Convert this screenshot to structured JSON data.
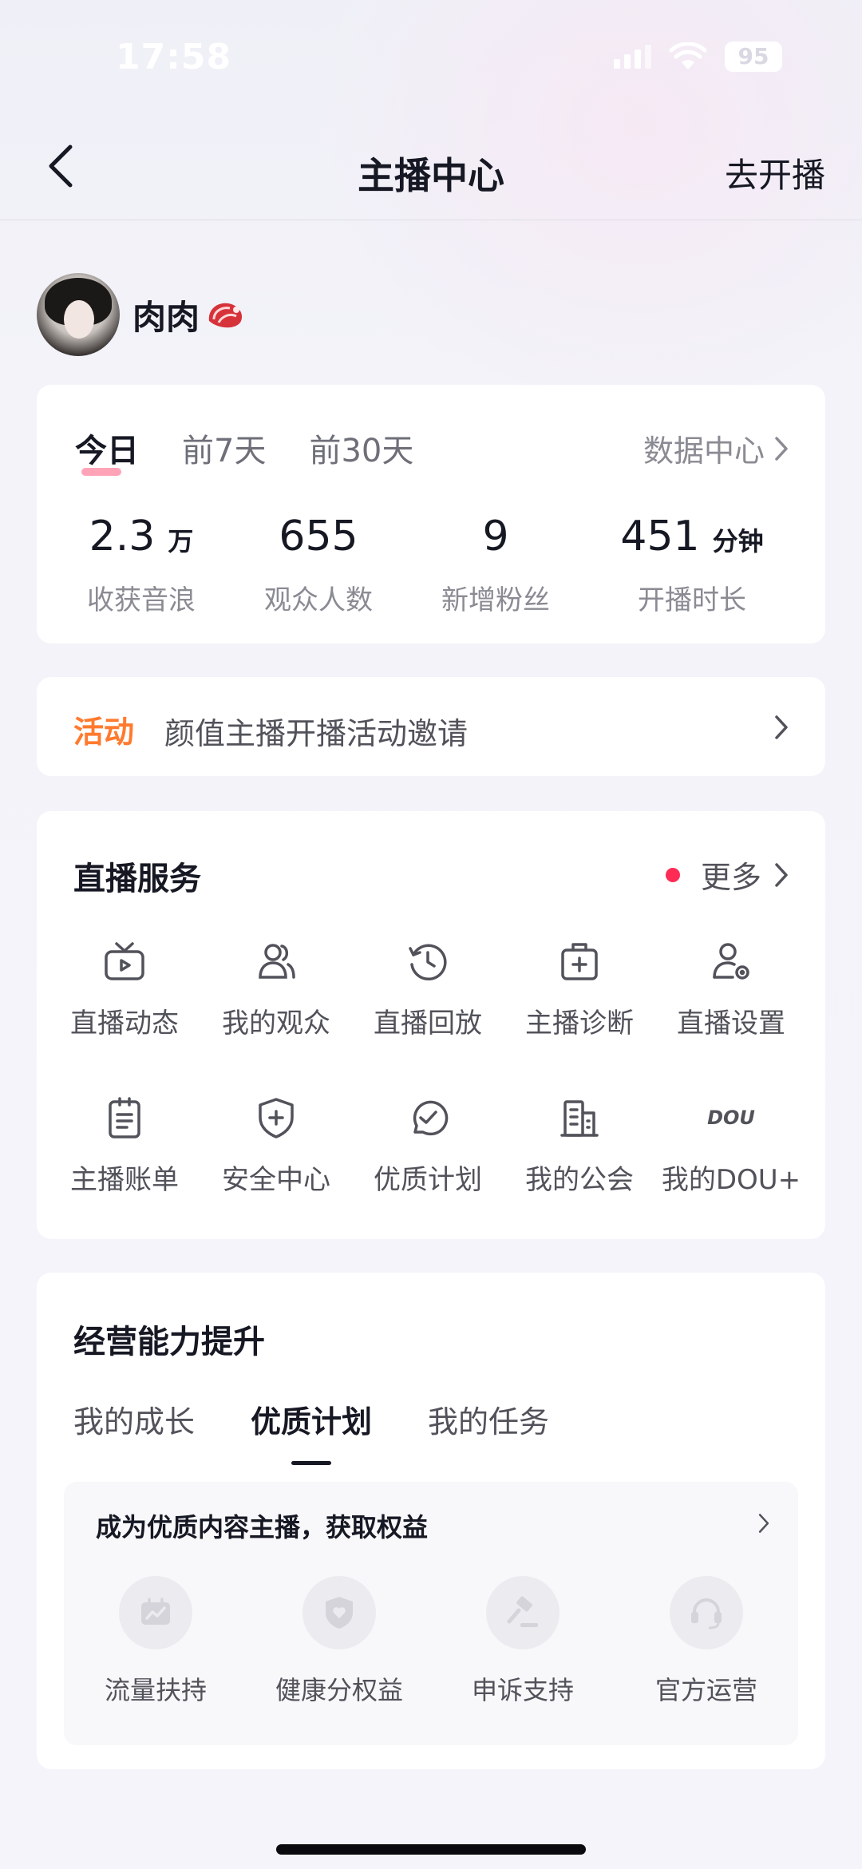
{
  "status_bar": {
    "time": "17:58",
    "battery": "95"
  },
  "nav": {
    "title": "主播中心",
    "action": "去开播"
  },
  "profile": {
    "name": "肉肉"
  },
  "stats": {
    "tabs": [
      "今日",
      "前7天",
      "前30天"
    ],
    "active_tab": "今日",
    "data_center": "数据中心",
    "items": [
      {
        "value": "2.3",
        "unit": "万",
        "label": "收获音浪"
      },
      {
        "value": "655",
        "unit": "",
        "label": "观众人数"
      },
      {
        "value": "9",
        "unit": "",
        "label": "新增粉丝"
      },
      {
        "value": "451",
        "unit": "分钟",
        "label": "开播时长"
      }
    ]
  },
  "activity": {
    "tag": "活动",
    "text": "颜值主播开播活动邀请"
  },
  "services": {
    "title": "直播服务",
    "more": "更多",
    "items": [
      {
        "label": "直播动态",
        "icon": "tv-icon"
      },
      {
        "label": "我的观众",
        "icon": "audience-icon"
      },
      {
        "label": "直播回放",
        "icon": "replay-icon"
      },
      {
        "label": "主播诊断",
        "icon": "medical-kit-icon"
      },
      {
        "label": "直播设置",
        "icon": "user-settings-icon"
      },
      {
        "label": "主播账单",
        "icon": "bill-icon"
      },
      {
        "label": "安全中心",
        "icon": "shield-plus-icon"
      },
      {
        "label": "优质计划",
        "icon": "check-circle-icon"
      },
      {
        "label": "我的公会",
        "icon": "building-icon"
      },
      {
        "label": "我的DOU+",
        "icon": "dou-plus-icon",
        "icon_text": "DOU"
      }
    ]
  },
  "growth": {
    "title": "经营能力提升",
    "tabs": [
      "我的成长",
      "优质计划",
      "我的任务"
    ],
    "active_tab": "优质计划",
    "panel_title": "成为优质内容主播，获取权益",
    "benefits": [
      {
        "label": "流量扶持",
        "icon": "traffic-chart-icon"
      },
      {
        "label": "健康分权益",
        "icon": "health-shield-icon"
      },
      {
        "label": "申诉支持",
        "icon": "gavel-icon"
      },
      {
        "label": "官方运营",
        "icon": "headset-icon"
      }
    ]
  },
  "colors": {
    "accent_red": "#fe2c55",
    "activity_orange": "#ff7a2e",
    "text_primary": "#161823",
    "text_secondary": "#8a8b93"
  }
}
